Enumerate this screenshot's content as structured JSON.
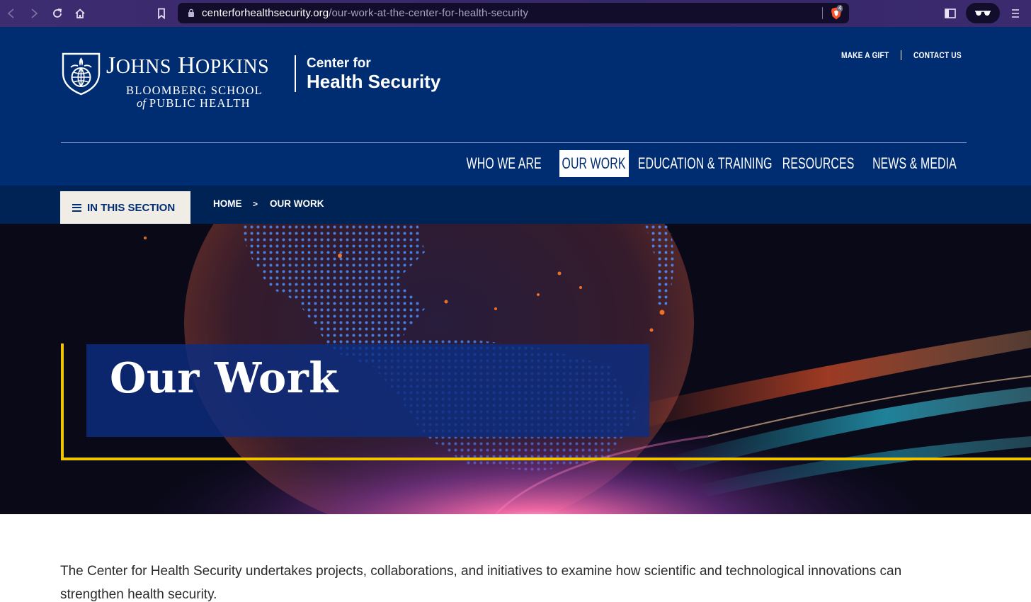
{
  "browser": {
    "url_domain": "centerforhealthsecurity.org",
    "url_path": "/our-work-at-the-center-for-health-security",
    "shields_count": "4"
  },
  "header": {
    "jh_name": {
      "first_initial": "J",
      "first_rest": "OHNS",
      "last_initial": "H",
      "last_rest": "OPKINS"
    },
    "jh_sub1": "BLOOMBERG SCHOOL",
    "jh_sub2_of": "of",
    "jh_sub2": "PUBLIC HEALTH",
    "center_line1": "Center for",
    "center_line2": "Health Security",
    "util_links": [
      "MAKE A GIFT",
      "CONTACT US"
    ]
  },
  "nav": {
    "items": [
      {
        "label": "WHO WE ARE",
        "active": false
      },
      {
        "label": "OUR WORK",
        "active": true
      },
      {
        "label": "EDUCATION & TRAINING",
        "active": false
      },
      {
        "label": "RESOURCES",
        "active": false
      },
      {
        "label": "NEWS & MEDIA",
        "active": false
      }
    ]
  },
  "breadcrumb": {
    "section_button": "IN THIS SECTION",
    "home": "HOME",
    "separator": ">",
    "current": "OUR WORK"
  },
  "hero": {
    "title": "Our Work"
  },
  "intro": {
    "text": "The Center for Health Security undertakes projects, collaborations, and initiatives to examine how scientific and technological innovations can strengthen health security."
  },
  "colors": {
    "brand_blue": "#002d72",
    "breadcrumb_bg": "#002355",
    "accent_gold": "#f1c400"
  }
}
